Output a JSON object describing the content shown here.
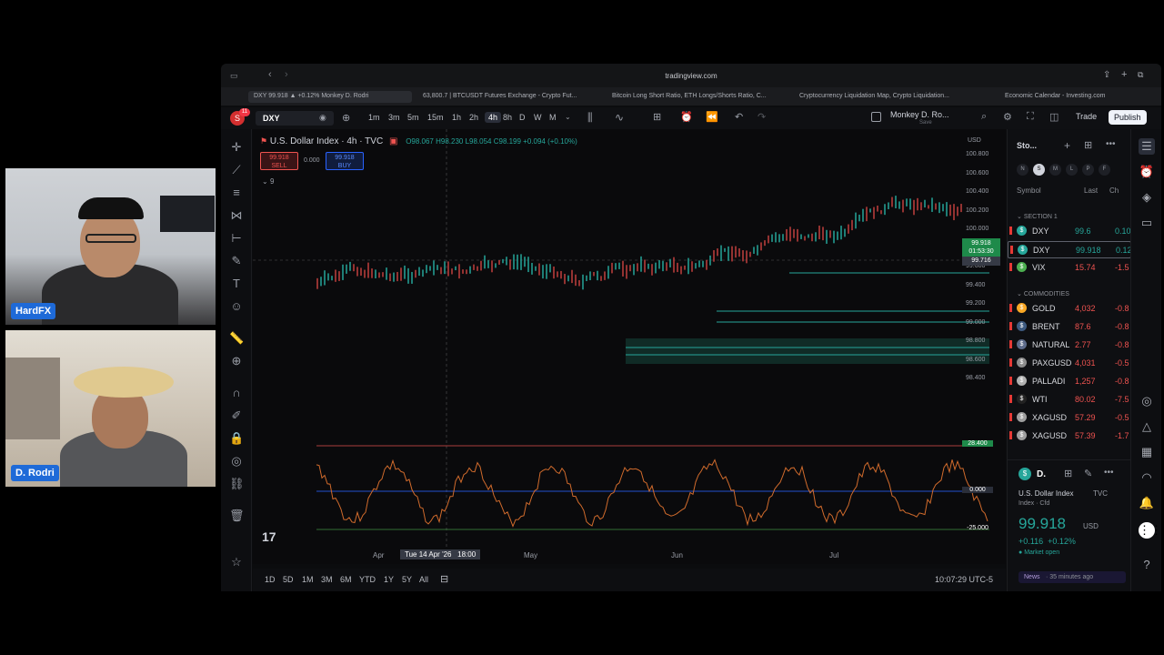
{
  "participants": [
    {
      "name": "HardFX"
    },
    {
      "name": "D. Rodri"
    }
  ],
  "browser": {
    "url": "tradingview.com",
    "tabs": [
      "DXY 99.918 ▲ +0.12% Monkey D. Rodri",
      "63,800.7 | BTCUSDT Futures Exchange - Crypto Fut...",
      "Bitcoin Long Short Ratio, ETH Longs/Shorts Ratio, C...",
      "Cryptocurrency Liquidation Map, Crypto Liquidation...",
      "Economic Calendar - Investing.com"
    ]
  },
  "toolbar": {
    "avatar_initial": "S",
    "avatar_badge": "11",
    "symbol": "DXY",
    "intervals": [
      "1m",
      "3m",
      "5m",
      "15m",
      "1h",
      "2h",
      "4h",
      "8h",
      "D",
      "W",
      "M"
    ],
    "active_interval": "4h",
    "layout_name": "Monkey D. Ro...",
    "layout_sub": "Save",
    "trade_label": "Trade",
    "publish_label": "Publish"
  },
  "legend": {
    "title": "U.S. Dollar Index · 4h · TVC",
    "ohlc": "O98.067 H98.230 L98.054 C98.199 +0.094 (+0.10%)",
    "sell_price": "99.918",
    "sell_label": "SELL",
    "spread": "0.000",
    "buy_price": "99.918",
    "buy_label": "BUY",
    "indicator_count": "9",
    "currency": "USD"
  },
  "price_scale": [
    "100.800",
    "100.600",
    "100.400",
    "100.200",
    "100.000",
    "99.800",
    "99.600",
    "99.400",
    "99.200",
    "99.000",
    "98.800",
    "98.600",
    "98.400"
  ],
  "price_tags": {
    "current": "99.918",
    "current_sub": "01:53:30",
    "crosshair": "99.716"
  },
  "osc_scale": [
    "28.400",
    "0.000",
    "-25.000"
  ],
  "time_axis": {
    "labels": [
      "Apr",
      "May",
      "Jun",
      "Jul"
    ],
    "crosshair_label": "Tue 14 Apr '26   18:00"
  },
  "bottom_bar": {
    "ranges": [
      "1D",
      "5D",
      "1M",
      "3M",
      "6M",
      "YTD",
      "1Y",
      "5Y",
      "All"
    ],
    "clock": "10:07:29 UTC-5"
  },
  "watchlist": {
    "title": "Sto...",
    "filters": [
      "N",
      "S",
      "M",
      "L",
      "P",
      "F"
    ],
    "columns": [
      "Symbol",
      "Last",
      "Ch"
    ],
    "section1": "SECTION 1",
    "commodities": "COMMODITIES",
    "rows1": [
      {
        "sym": "DXY",
        "last": "99.6",
        "chg": "0.10",
        "dir": "green"
      },
      {
        "sym": "DXY",
        "last": "99.918",
        "chg": "0.12",
        "dir": "green"
      },
      {
        "sym": "VIX",
        "last": "15.74",
        "chg": "-1.5",
        "dir": "red"
      }
    ],
    "rows2": [
      {
        "sym": "GOLD",
        "last": "4,032",
        "chg": "-0.8",
        "dir": "red"
      },
      {
        "sym": "BRENT",
        "last": "87.6",
        "chg": "-0.8",
        "dir": "red"
      },
      {
        "sym": "NATURAL",
        "last": "2.77",
        "chg": "-0.8",
        "dir": "red"
      },
      {
        "sym": "PAXGUSD",
        "last": "4,031",
        "chg": "-0.5",
        "dir": "red"
      },
      {
        "sym": "PALLADI",
        "last": "1,257",
        "chg": "-0.8",
        "dir": "red"
      },
      {
        "sym": "WTI",
        "last": "80.02",
        "chg": "-7.5",
        "dir": "red"
      },
      {
        "sym": "XAGUSD",
        "last": "57.29",
        "chg": "-0.5",
        "dir": "red"
      },
      {
        "sym": "XAGUSD",
        "last": "57.39",
        "chg": "-1.7",
        "dir": "red"
      }
    ]
  },
  "details": {
    "short": "D.",
    "name": "U.S. Dollar Index",
    "exchange": "TVC",
    "type": "Index · Cfd",
    "price": "99.918",
    "currency": "USD",
    "change": "+0.116  +0.12%",
    "status": "Market open",
    "news_label": "News",
    "news_time": "· 35 minutes ago"
  },
  "colors": {
    "up": "#26a69a",
    "down": "#ef5350",
    "accent": "#2962ff"
  }
}
